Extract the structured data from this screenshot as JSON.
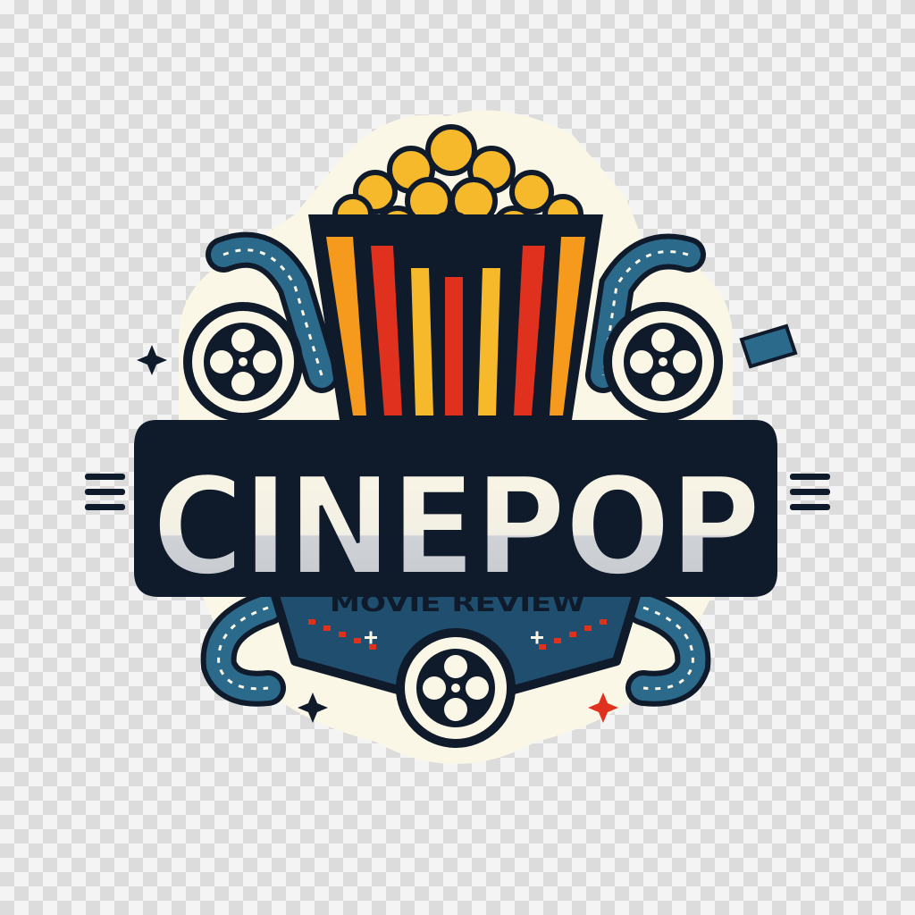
{
  "logo": {
    "brand_name": "CINEPOP",
    "tagline": "MOVIE REVIEW"
  },
  "colors": {
    "navy": "#0f1a2a",
    "cream": "#fbf7e6",
    "film_blue": "#2c6a8c",
    "popcorn_yellow": "#f6b92b",
    "stripe_red": "#e0301e",
    "stripe_orange": "#f59a1c",
    "star_red": "#e0301e"
  },
  "icons": [
    "popcorn-bucket-icon",
    "film-reel-icon",
    "film-strip-icon",
    "sparkle-icon"
  ]
}
